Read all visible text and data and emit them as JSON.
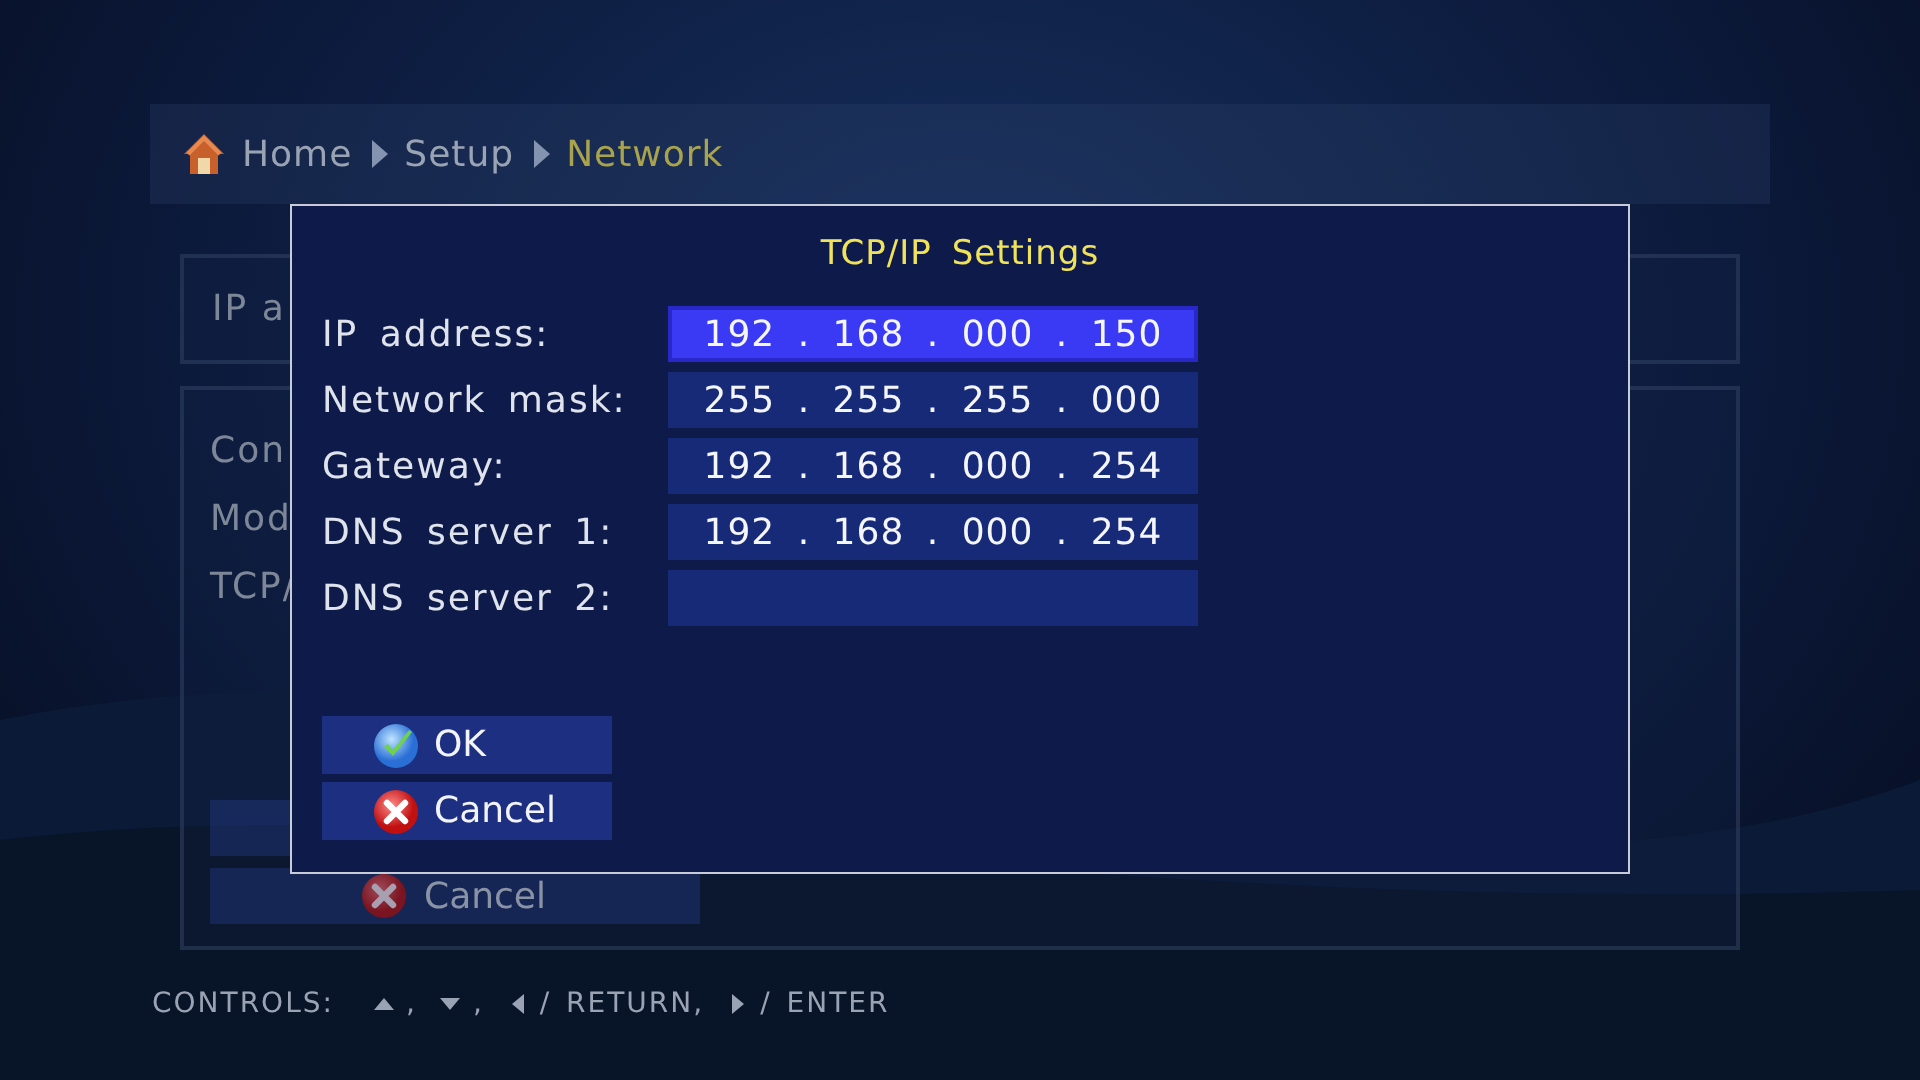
{
  "breadcrumb": [
    {
      "label": "Home",
      "kind": "home",
      "selected": false
    },
    {
      "label": "Setup",
      "kind": "crumb",
      "selected": false
    },
    {
      "label": "Network",
      "kind": "crumb",
      "selected": true
    }
  ],
  "background_page": {
    "field_label": "IP a",
    "menu_items": [
      "Con",
      "Mod",
      "TCP/"
    ],
    "buttons": [
      {
        "kind": "blank"
      },
      {
        "kind": "cancel",
        "label": "Cancel"
      }
    ]
  },
  "dialog": {
    "title": "TCP/IP Settings",
    "fields": [
      {
        "label": "IP address:",
        "value": "192 . 168 . 000 . 150",
        "selected": true
      },
      {
        "label": "Network mask:",
        "value": "255 . 255 . 255 . 000",
        "selected": false
      },
      {
        "label": "Gateway:",
        "value": "192 . 168 . 000 . 254",
        "selected": false
      },
      {
        "label": "DNS server 1:",
        "value": "192 . 168 . 000 . 254",
        "selected": false
      },
      {
        "label": "DNS server 2:",
        "selected": false
      }
    ],
    "buttons": [
      {
        "kind": "ok",
        "label": "OK"
      },
      {
        "kind": "cancel",
        "label": "Cancel"
      }
    ]
  },
  "footer": {
    "label": "CONTROLS:",
    "hints": [
      {
        "kind": "up",
        "text": ","
      },
      {
        "kind": "down",
        "text": ","
      },
      {
        "kind": "left",
        "text": "/ RETURN,"
      },
      {
        "kind": "right",
        "text": "/ ENTER"
      }
    ]
  }
}
